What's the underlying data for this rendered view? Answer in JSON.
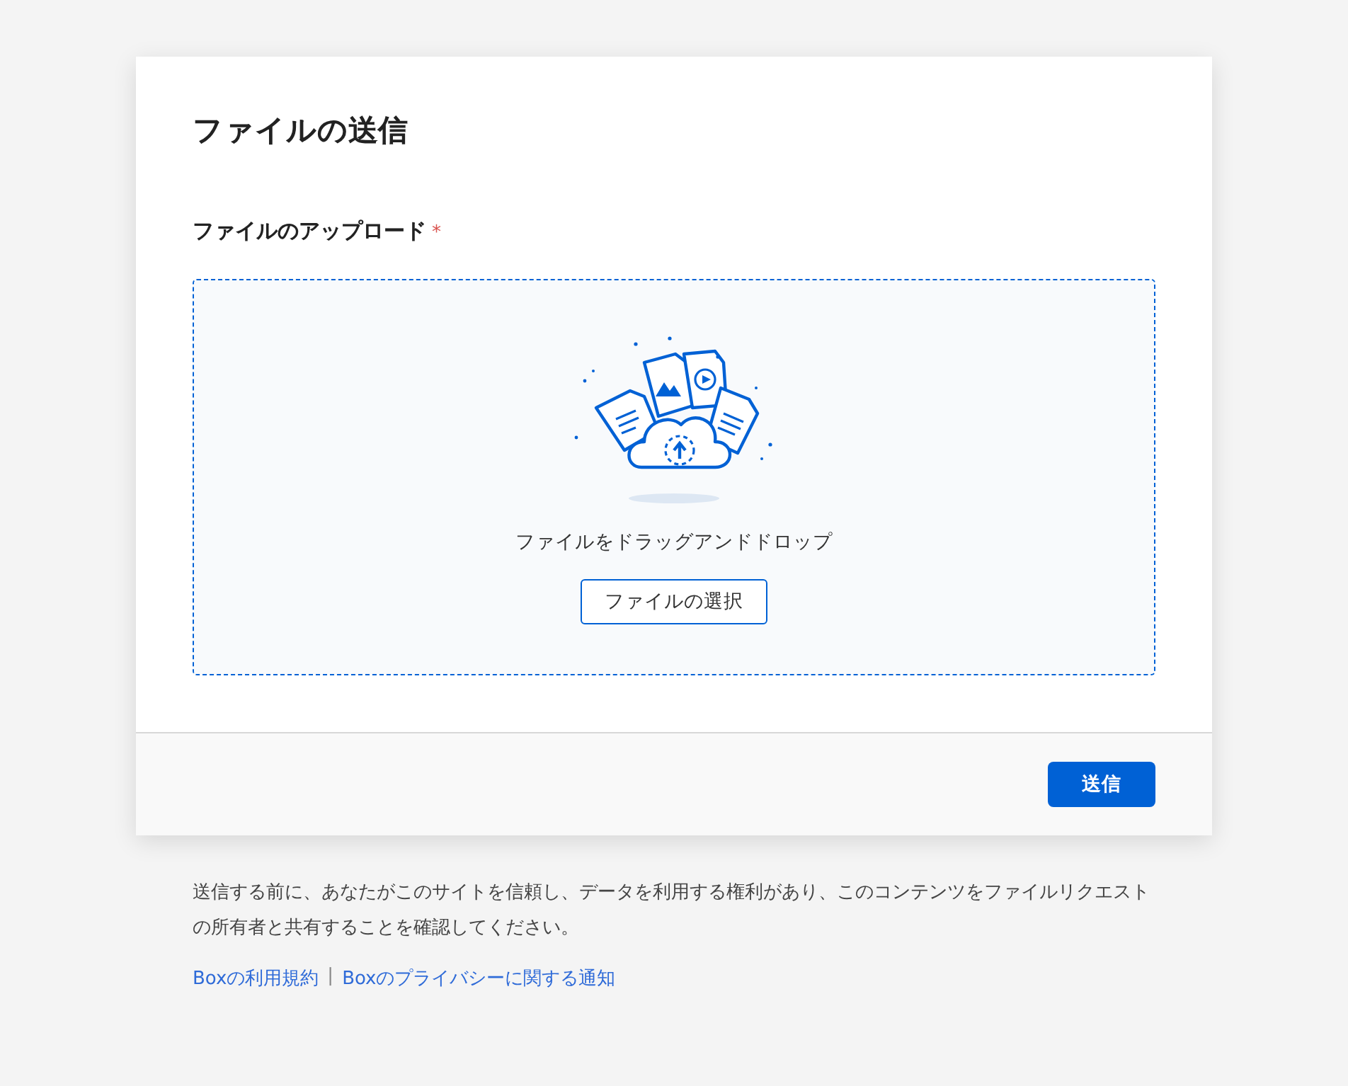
{
  "title": "ファイルの送信",
  "upload": {
    "label": "ファイルのアップロード",
    "required_mark": "*",
    "drop_text": "ファイルをドラッグアンドドロップ",
    "choose_button": "ファイルの選択"
  },
  "submit_button": "送信",
  "notice": "送信する前に、あなたがこのサイトを信頼し、データを利用する権利があり、このコンテンツをファイルリクエストの所有者と共有することを確認してください。",
  "links": [
    "Boxの利用規約",
    "Boxのプライバシーに関する通知"
  ],
  "link_separator": "|"
}
